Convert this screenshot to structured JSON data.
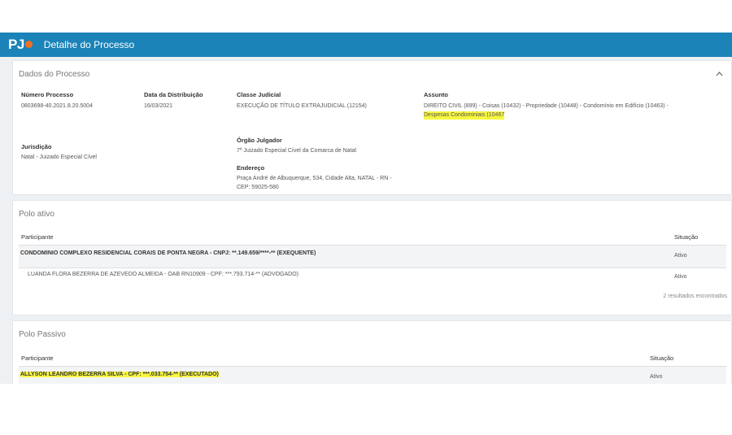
{
  "header": {
    "logo": "PJ",
    "title": "Detalhe do Processo"
  },
  "dados": {
    "title": "Dados do Processo",
    "fields": {
      "numero": {
        "label": "Número Processo",
        "value": "0803698-40.2021.8.20.5004"
      },
      "data": {
        "label": "Data da Distribuição",
        "value": "16/03/2021"
      },
      "classe": {
        "label": "Classe Judicial",
        "value": "EXECUÇÃO DE TÍTULO EXTRAJUDICIAL (12154)"
      },
      "assunto": {
        "label": "Assunto",
        "line1": "DIREITO CIVIL (899) - Coisas (10432) - Propriedade (10448) - Condomínio em Edifício (10463) -",
        "line2": "Despesas Condominiais (10467"
      },
      "jurisdicao": {
        "label": "Jurisdição",
        "value": "Natal - Juizado Especial Cível"
      },
      "orgao": {
        "label": "Órgão Julgador",
        "value": "7º Juizado Especial Cível da Comarca de Natal"
      },
      "endereco": {
        "label": "Endereço",
        "line1": "Praça André de Albuquerque, 534, Cidade Alta, NATAL - RN -",
        "line2": "CEP: 59025-580"
      }
    }
  },
  "polo_ativo": {
    "title": "Polo ativo",
    "col_participante": "Participante",
    "col_situacao": "Situação",
    "rows": [
      {
        "participante": "CONDOMINIO COMPLEXO RESIDENCIAL CORAIS DE PONTA NEGRA - CNPJ: **.149.659/****-** (EXEQUENTE)",
        "situacao": "Ativo"
      },
      {
        "participante": "LUANDA FLORA BEZERRA DE AZEVEDO ALMEIDA - OAB RN10909 - CPF: ***.793.714-** (ADVOGADO)",
        "situacao": "Ativo"
      }
    ],
    "results": "2 resultados encontrados"
  },
  "polo_passivo": {
    "title": "Polo Passivo",
    "col_participante": "Participante",
    "col_situacao": "Situação",
    "rows": [
      {
        "participante": "ALLYSON LEANDRO BEZERRA SILVA - CPF: ***.033.754-** (EXECUTADO)",
        "situacao": "Ativo"
      }
    ]
  }
}
